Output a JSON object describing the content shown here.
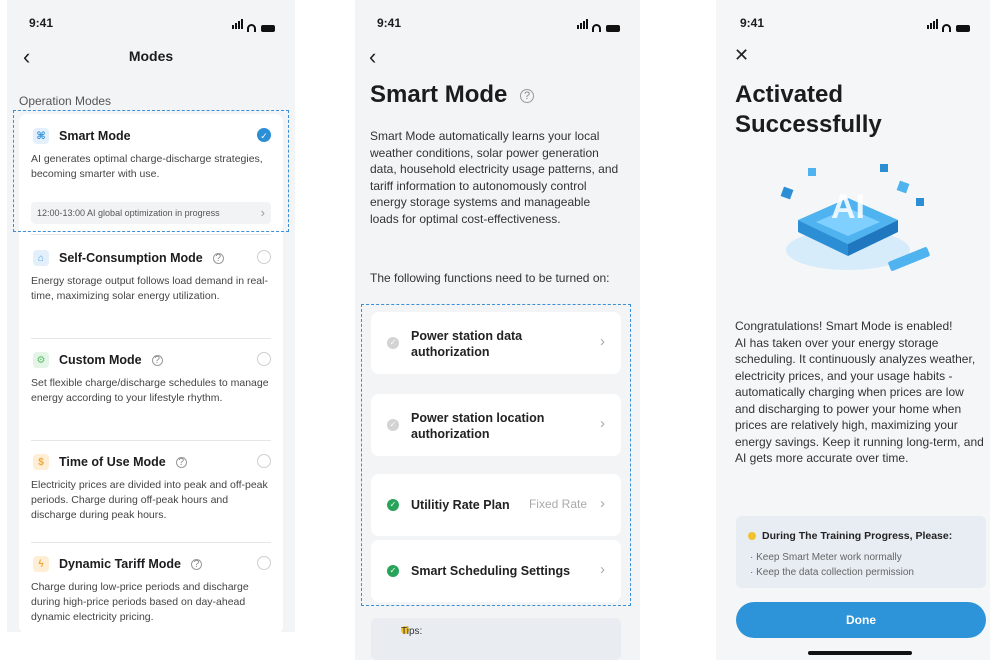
{
  "status": {
    "time": "9:41"
  },
  "screen1": {
    "title": "Modes",
    "section_label": "Operation Modes",
    "modes": [
      {
        "name": "Smart Mode",
        "desc": "AI generates optimal charge-discharge strategies, becoming smarter with use.",
        "selected": true,
        "schedule": "12:00-13:00  AI global optimization in progress",
        "icon": "ai-chip-icon",
        "color": "#2c8fd6"
      },
      {
        "name": "Self-Consumption Mode",
        "desc": "Energy storage output follows load demand in real-time, maximizing solar energy utilization.",
        "selected": false,
        "icon": "home-icon",
        "color": "#4aa3df"
      },
      {
        "name": "Custom Mode",
        "desc": "Set flexible charge/discharge schedules to manage energy according to your lifestyle rhythm.",
        "selected": false,
        "icon": "gear-icon",
        "color": "#5cbf6a"
      },
      {
        "name": "Time of Use Mode",
        "desc": "Electricity prices are divided into peak and off-peak periods. Charge during off-peak hours and discharge during peak hours.",
        "selected": false,
        "icon": "price-tag-icon",
        "color": "#f0a73a"
      },
      {
        "name": "Dynamic Tariff Mode",
        "desc": "Charge during low-price periods and discharge during high-price periods based on day-ahead dynamic electricity pricing.",
        "selected": false,
        "icon": "bolt-icon",
        "color": "#f0a73a"
      }
    ]
  },
  "screen2": {
    "title": "Smart Mode",
    "description": "Smart Mode automatically learns your local weather conditions, solar power generation data, household electricity usage patterns, and tariff information to autonomously control energy storage systems and manageable loads for optimal cost-effectiveness.",
    "functions_label": "The following functions need to be turned on:",
    "requirements": [
      {
        "label": "Power station data authorization",
        "value": "",
        "done": false
      },
      {
        "label": "Power station location authorization",
        "value": "",
        "done": false
      },
      {
        "label": "Utilitiy Rate Plan",
        "value": "Fixed Rate",
        "done": true
      },
      {
        "label": "Smart Scheduling Settings",
        "value": "",
        "done": true
      }
    ],
    "tips_label": "Tips:"
  },
  "screen3": {
    "title": "Activated Successfully",
    "message": "Congratulations! Smart Mode is enabled!\nAI has taken over your energy storage scheduling. It continuously analyzes weather, electricity prices, and your usage habits - automatically charging when prices are low and discharging to power your home when prices are relatively high, maximizing your energy savings. Keep it running long-term, and AI gets more accurate over time.",
    "illustration_text": "AI",
    "training_title": "During The Training Progress, Please:",
    "training_items": [
      "· Keep Smart Meter work normally",
      "· Keep the data collection permission"
    ],
    "done_label": "Done"
  }
}
